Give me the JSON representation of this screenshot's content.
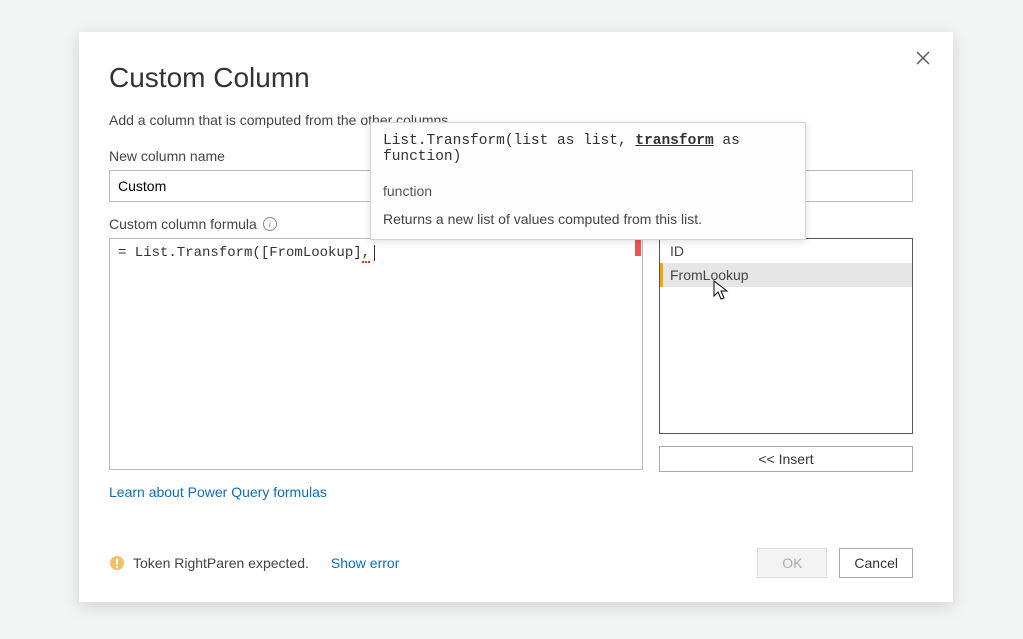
{
  "dialog": {
    "title": "Custom Column",
    "subtitle": "Add a column that is computed from the other columns.",
    "newColumnLabel": "New column name",
    "newColumnValue": "Custom",
    "formulaLabel": "Custom column formula",
    "formulaPrefix": "= List.Transform([FromLookup]",
    "formulaSquiggle": ",",
    "learnLink": "Learn about Power Query formulas",
    "availableColumns": [
      {
        "name": "ID",
        "selected": false
      },
      {
        "name": "FromLookup",
        "selected": true
      }
    ],
    "insertLabel": "<< Insert",
    "status": {
      "text": "Token RightParen expected.",
      "showErrorLabel": "Show error"
    },
    "buttons": {
      "ok": "OK",
      "cancel": "Cancel"
    }
  },
  "tooltip": {
    "fn": "List.Transform",
    "arg1": "list",
    "arg1type": "list",
    "arg2": "transform",
    "arg2type": "function",
    "kind": "function",
    "desc": "Returns a new list of values computed from this list."
  }
}
